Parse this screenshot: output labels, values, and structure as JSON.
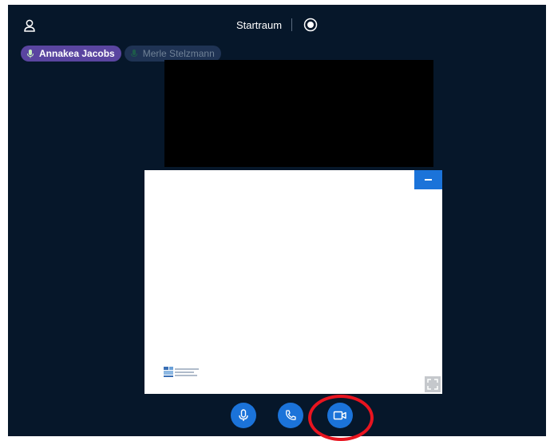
{
  "header": {
    "room_title": "Startraum",
    "user_icon": "user-icon",
    "record_icon": "record-icon"
  },
  "participants": [
    {
      "name": "Annakea Jacobs",
      "state": "talking",
      "icon": "microphone-icon"
    },
    {
      "name": "Merle Stelzmann",
      "state": "muted",
      "icon": "microphone-icon"
    }
  ],
  "presentation": {
    "minimize_icon": "minimize-icon",
    "fullscreen_icon": "fullscreen-icon"
  },
  "controls": {
    "items": [
      {
        "name": "mute-button",
        "icon": "microphone-icon"
      },
      {
        "name": "leave-audio-button",
        "icon": "phone-icon"
      },
      {
        "name": "share-webcam-button",
        "icon": "camera-icon",
        "highlighted": true
      }
    ]
  },
  "colors": {
    "background": "#06172a",
    "accent": "#1b73d9",
    "talking_chip": "#5a45a0",
    "muted_chip": "#1f3354",
    "highlight_ring": "#e8141f"
  }
}
